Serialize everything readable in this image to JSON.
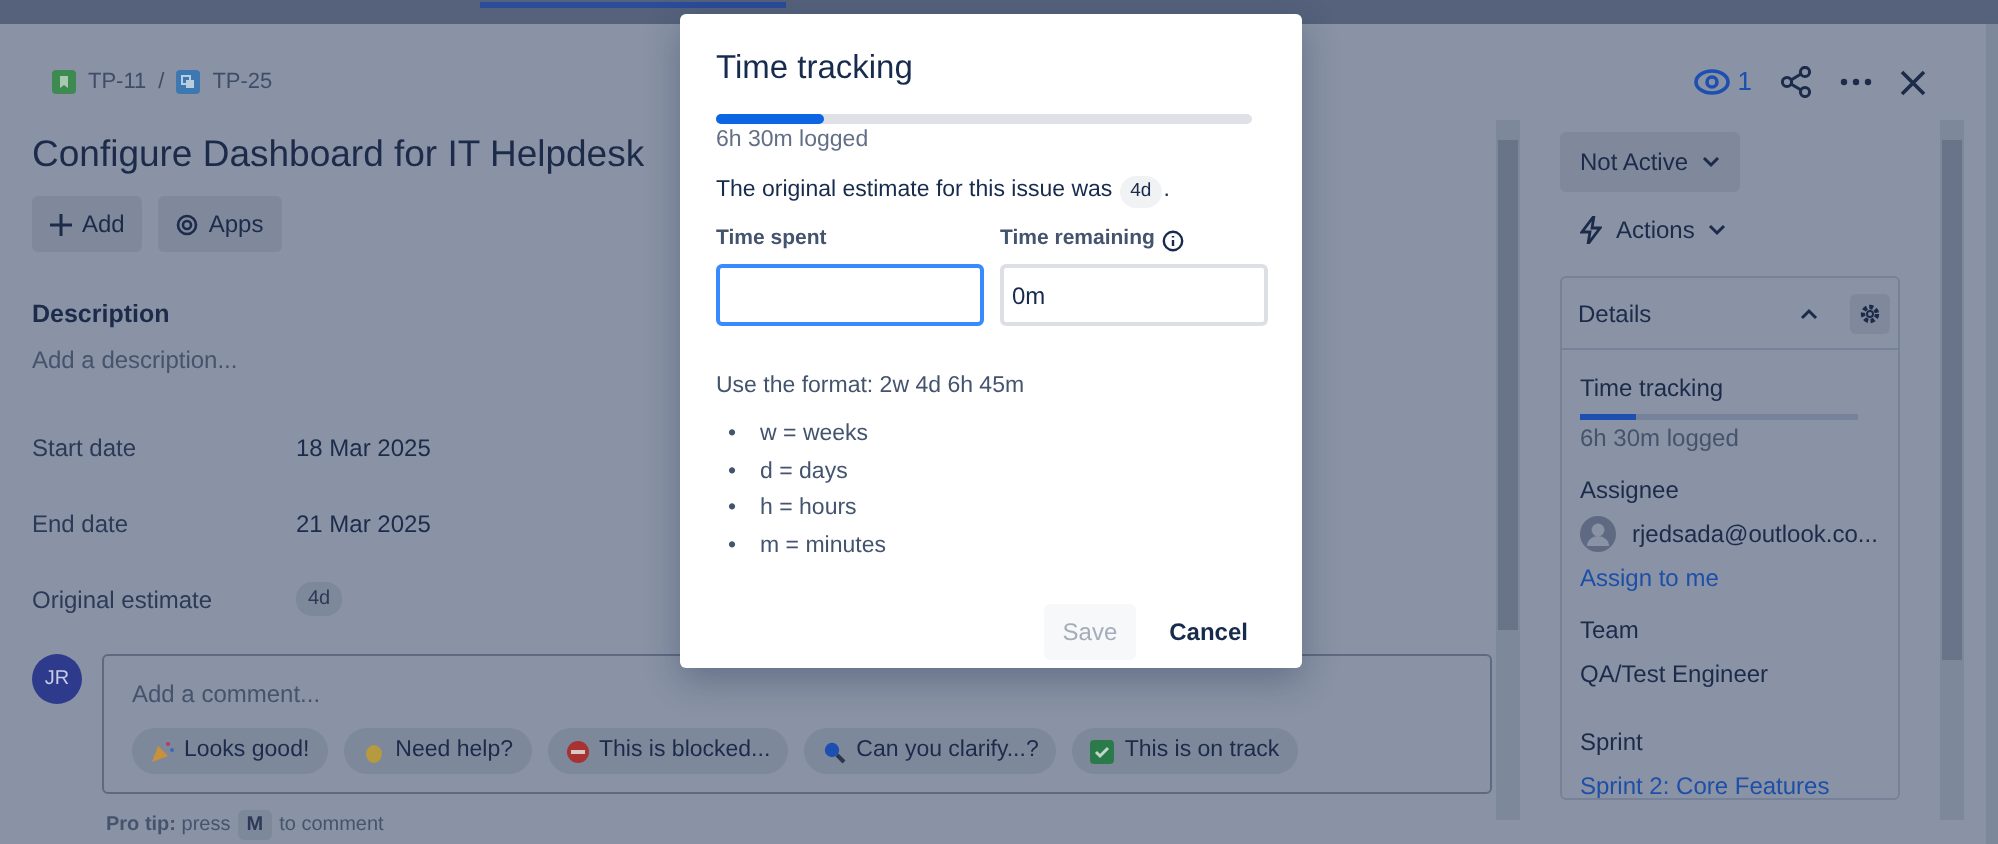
{
  "breadcrumbs": {
    "items": [
      {
        "key": "TP-11",
        "kind": "story"
      },
      {
        "key": "TP-25",
        "kind": "subtask"
      }
    ],
    "separator": "/"
  },
  "header": {
    "watchers": "1"
  },
  "issue": {
    "title": "Configure Dashboard for IT Helpdesk",
    "buttons": [
      {
        "label": "Add",
        "kind": "plus"
      },
      {
        "label": "Apps",
        "kind": "apps"
      }
    ],
    "description": {
      "heading": "Description",
      "placeholder": "Add a description..."
    },
    "fields": [
      {
        "label": "Start date",
        "value": "18 Mar 2025",
        "kind": "text"
      },
      {
        "label": "End date",
        "value": "21 Mar 2025",
        "kind": "text"
      },
      {
        "label": "Original estimate",
        "value": "4d",
        "kind": "badge"
      }
    ],
    "comment": {
      "avatar": "JR",
      "placeholder": "Add a comment...",
      "quick_replies": [
        {
          "label": "Looks good!",
          "kind": "party"
        },
        {
          "label": "Need help?",
          "kind": "wave"
        },
        {
          "label": "This is blocked...",
          "kind": "blocked"
        },
        {
          "label": "Can you clarify...?",
          "kind": "search"
        },
        {
          "label": "This is on track",
          "kind": "check"
        }
      ],
      "tip": "**Pro tip:** press",
      "tip_key": "M",
      "tip_end": "to comment"
    }
  },
  "sidebar": {
    "status": "Not Active",
    "actions": "Actions",
    "details": {
      "title": "Details",
      "time_tracking": {
        "label": "Time tracking",
        "level": 0.2,
        "logged": "6h 30m logged"
      },
      "assignee": {
        "label": "Assignee",
        "value": "rjedsada@outlook.co...",
        "link": "Assign to me"
      },
      "team": {
        "label": "Team",
        "value": "QA/Test Engineer"
      },
      "sprint": {
        "label": "Sprint",
        "value": "Sprint 2: Core Features"
      }
    }
  },
  "modal": {
    "title": "Time tracking",
    "level": 0.2,
    "logged": "6h 30m logged",
    "estimate_text": "The original estimate for this issue was",
    "estimate_badge": "4d",
    "estimate_end": ".",
    "fields": [
      {
        "label": "Time spent",
        "focused": true,
        "kind": "plain"
      },
      {
        "label": "Time remaining",
        "value": "0m",
        "focused": false,
        "kind": "with_info"
      }
    ],
    "hint": "Use the format: 2w 4d 6h 45m",
    "units": [
      {
        "bullet": "•",
        "text": "w = weeks"
      },
      {
        "bullet": "•",
        "text": "d = days"
      },
      {
        "bullet": "•",
        "text": "h = hours"
      },
      {
        "bullet": "•",
        "text": "m = minutes"
      }
    ],
    "buttons": [
      {
        "label": "Save",
        "kind": "primary",
        "disabled": true
      },
      {
        "label": "Cancel",
        "kind": "subtle",
        "disabled": false
      }
    ]
  }
}
